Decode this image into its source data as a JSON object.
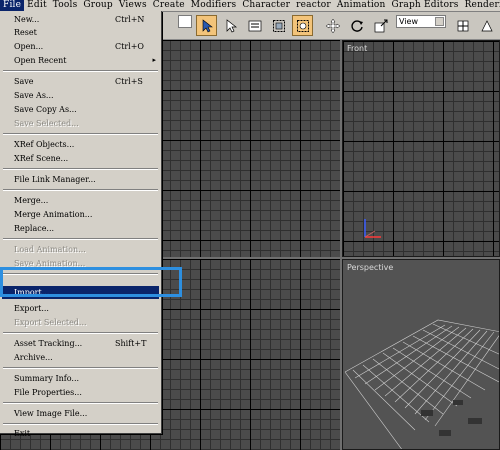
{
  "menubar": {
    "items": [
      "File",
      "Edit",
      "Tools",
      "Group",
      "Views",
      "Create",
      "Modifiers",
      "Character",
      "reactor",
      "Animation",
      "Graph Editors",
      "Rendering"
    ]
  },
  "toolbar": {
    "view_select": "View"
  },
  "viewports": {
    "front_label": "Front",
    "perspective_label": "Perspective"
  },
  "file_menu": {
    "items": [
      {
        "label": "New...",
        "shortcut": "Ctrl+N"
      },
      {
        "label": "Reset",
        "shortcut": ""
      },
      {
        "label": "Open...",
        "shortcut": "Ctrl+O"
      },
      {
        "label": "Open Recent",
        "shortcut": ""
      },
      {
        "label": "Save",
        "shortcut": "Ctrl+S"
      },
      {
        "label": "Save As...",
        "shortcut": ""
      },
      {
        "label": "Save Copy As...",
        "shortcut": ""
      },
      {
        "label": "Save Selected...",
        "shortcut": ""
      },
      {
        "label": "XRef Objects...",
        "shortcut": ""
      },
      {
        "label": "XRef Scene...",
        "shortcut": ""
      },
      {
        "label": "File Link Manager...",
        "shortcut": ""
      },
      {
        "label": "Merge...",
        "shortcut": ""
      },
      {
        "label": "Merge Animation...",
        "shortcut": ""
      },
      {
        "label": "Replace...",
        "shortcut": ""
      },
      {
        "label": "Load Animation...",
        "shortcut": ""
      },
      {
        "label": "Save Animation...",
        "shortcut": ""
      },
      {
        "label": "Import...",
        "shortcut": ""
      },
      {
        "label": "Export...",
        "shortcut": ""
      },
      {
        "label": "Export Selected...",
        "shortcut": ""
      },
      {
        "label": "Asset Tracking...",
        "shortcut": "Shift+T"
      },
      {
        "label": "Archive...",
        "shortcut": ""
      },
      {
        "label": "Summary Info...",
        "shortcut": ""
      },
      {
        "label": "File Properties...",
        "shortcut": ""
      },
      {
        "label": "View Image File...",
        "shortcut": ""
      },
      {
        "label": "Exit",
        "shortcut": ""
      }
    ]
  },
  "colors": {
    "menu_bg": "#d4d0c8",
    "highlight_bg": "#0a246a",
    "annotation_box": "#2d8fe0",
    "active_tool": "#f3c47a"
  },
  "icons": {
    "open_recent_arrow": "▸"
  }
}
